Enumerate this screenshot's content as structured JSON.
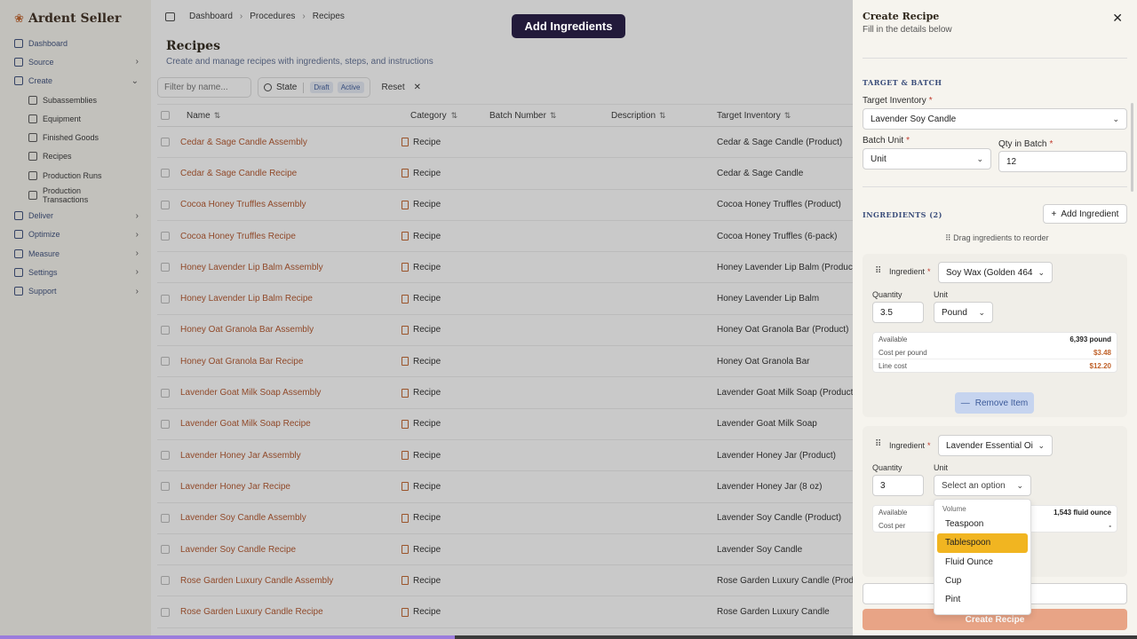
{
  "brand": {
    "name": "Ardent Seller",
    "mark": "❀"
  },
  "sidebar": {
    "items": [
      {
        "label": "Dashboard",
        "chev": ""
      },
      {
        "label": "Source",
        "chev": "›"
      },
      {
        "label": "Create",
        "chev": "⌄"
      },
      {
        "label": "Deliver",
        "chev": "›"
      },
      {
        "label": "Optimize",
        "chev": "›"
      },
      {
        "label": "Measure",
        "chev": "›"
      },
      {
        "label": "Settings",
        "chev": "›"
      },
      {
        "label": "Support",
        "chev": "›"
      }
    ],
    "sub": [
      "Subassemblies",
      "Equipment",
      "Finished Goods",
      "Recipes",
      "Production Runs",
      "Production Transactions"
    ]
  },
  "breadcrumb": [
    "Dashboard",
    "Procedures",
    "Recipes"
  ],
  "page": {
    "title": "Recipes",
    "subtitle": "Create and manage recipes with ingredients, steps, and instructions"
  },
  "toolbar": {
    "filter_placeholder": "Filter by name...",
    "state_label": "State",
    "pill_draft": "Draft",
    "pill_active": "Active",
    "reset_label": "Reset"
  },
  "table": {
    "headers": [
      "Name",
      "Category",
      "Batch Number",
      "Description",
      "Target Inventory"
    ],
    "rows": [
      {
        "name": "Cedar & Sage Candle Assembly",
        "category": "Recipe",
        "target": "Cedar & Sage Candle (Product)"
      },
      {
        "name": "Cedar & Sage Candle Recipe",
        "category": "Recipe",
        "target": "Cedar & Sage Candle"
      },
      {
        "name": "Cocoa Honey Truffles Assembly",
        "category": "Recipe",
        "target": "Cocoa Honey Truffles (Product)"
      },
      {
        "name": "Cocoa Honey Truffles Recipe",
        "category": "Recipe",
        "target": "Cocoa Honey Truffles (6-pack)"
      },
      {
        "name": "Honey Lavender Lip Balm Assembly",
        "category": "Recipe",
        "target": "Honey Lavender Lip Balm (Product"
      },
      {
        "name": "Honey Lavender Lip Balm Recipe",
        "category": "Recipe",
        "target": "Honey Lavender Lip Balm"
      },
      {
        "name": "Honey Oat Granola Bar Assembly",
        "category": "Recipe",
        "target": "Honey Oat Granola Bar (Product)"
      },
      {
        "name": "Honey Oat Granola Bar Recipe",
        "category": "Recipe",
        "target": "Honey Oat Granola Bar"
      },
      {
        "name": "Lavender Goat Milk Soap Assembly",
        "category": "Recipe",
        "target": "Lavender Goat Milk Soap (Product)"
      },
      {
        "name": "Lavender Goat Milk Soap Recipe",
        "category": "Recipe",
        "target": "Lavender Goat Milk Soap"
      },
      {
        "name": "Lavender Honey Jar Assembly",
        "category": "Recipe",
        "target": "Lavender Honey Jar (Product)"
      },
      {
        "name": "Lavender Honey Jar Recipe",
        "category": "Recipe",
        "target": "Lavender Honey Jar (8 oz)"
      },
      {
        "name": "Lavender Soy Candle Assembly",
        "category": "Recipe",
        "target": "Lavender Soy Candle (Product)"
      },
      {
        "name": "Lavender Soy Candle Recipe",
        "category": "Recipe",
        "target": "Lavender Soy Candle"
      },
      {
        "name": "Rose Garden Luxury Candle Assembly",
        "category": "Recipe",
        "target": "Rose Garden Luxury Candle (Produ"
      },
      {
        "name": "Rose Garden Luxury Candle Recipe",
        "category": "Recipe",
        "target": "Rose Garden Luxury Candle"
      }
    ]
  },
  "tooltip": "Add Ingredients",
  "drawer": {
    "title": "Create Recipe",
    "subtitle": "Fill in the details below",
    "section_target": "TARGET & BATCH",
    "target_label": "Target Inventory",
    "target_value": "Lavender Soy Candle",
    "batch_unit_label": "Batch Unit",
    "batch_unit_value": "Unit",
    "qty_label": "Qty in Batch",
    "qty_value": "12",
    "section_ingredients": "INGREDIENTS (2)",
    "add_ingredient": "Add Ingredient",
    "drag_hint": "Drag ingredients to reorder",
    "ingredient_label": "Ingredient",
    "quantity_label": "Quantity",
    "unit_label": "Unit",
    "ing1": {
      "name": "Soy Wax (Golden 464",
      "quantity": "3.5",
      "unit": "Pound",
      "available_label": "Available",
      "available": "6,393 pound",
      "cost_label": "Cost per pound",
      "cost": "$3.48",
      "line_label": "Line cost",
      "line": "$12.20",
      "remove": "Remove Item"
    },
    "ing2": {
      "name": "Lavender Essential Oi",
      "quantity": "3",
      "unit_placeholder": "Select an option",
      "available_label": "Available",
      "available": "1,543 fluid ounce",
      "cost_label": "Cost per",
      "cost": "-"
    },
    "create_button": "Create Recipe"
  },
  "unit_menu": {
    "group": "Volume",
    "options": [
      "Teaspoon",
      "Tablespoon",
      "Fluid Ounce",
      "Cup",
      "Pint"
    ],
    "selected": "Tablespoon"
  },
  "colors": {
    "accent": "#c0622a",
    "link": "#b3542a",
    "highlight": "#f1b521"
  },
  "progress": 0.4
}
